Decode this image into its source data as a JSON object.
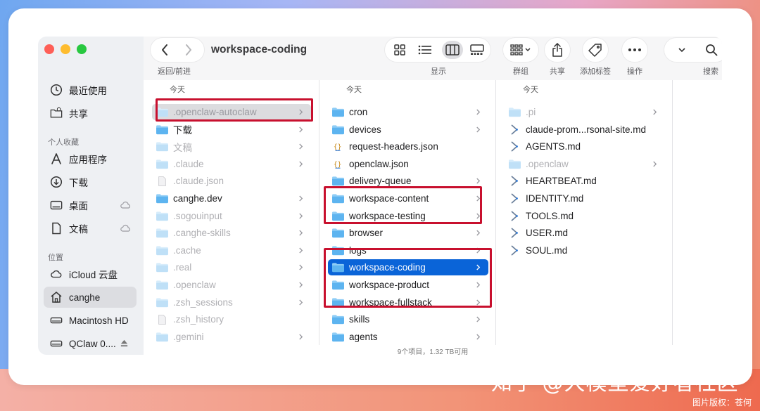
{
  "window_title": "workspace-coding",
  "toolbar": {
    "back_forward_label": "返回/前进",
    "view_label": "显示",
    "group_label": "群组",
    "share_label": "共享",
    "tags_label": "添加标签",
    "actions_label": "操作",
    "search_label": "搜索"
  },
  "sidebar": {
    "items_top": [
      {
        "label": "最近使用",
        "icon": "clock-icon"
      },
      {
        "label": "共享",
        "icon": "shared-folder-icon"
      }
    ],
    "favorites_title": "个人收藏",
    "favorites": [
      {
        "label": "应用程序",
        "icon": "applications-icon"
      },
      {
        "label": "下载",
        "icon": "download-icon"
      },
      {
        "label": "桌面",
        "icon": "desktop-icon"
      },
      {
        "label": "文稿",
        "icon": "document-icon"
      }
    ],
    "locations_title": "位置",
    "locations": [
      {
        "label": "iCloud 云盘",
        "icon": "cloud-icon"
      },
      {
        "label": "canghe",
        "icon": "home-icon"
      },
      {
        "label": "Macintosh HD",
        "icon": "disk-icon"
      },
      {
        "label": "QClaw 0....",
        "icon": "external-disk-icon"
      }
    ]
  },
  "columns": [
    {
      "header": "今天",
      "rows": [
        {
          "label": ".openclaw-autoclaw",
          "type": "folder",
          "dim": true,
          "chevron": true,
          "state": "selected-inactive"
        },
        {
          "label": "下载",
          "type": "folder",
          "dim": false,
          "chevron": true
        },
        {
          "label": "文稿",
          "type": "folder",
          "dim": true,
          "chevron": true
        },
        {
          "label": ".claude",
          "type": "folder",
          "dim": true,
          "chevron": true
        },
        {
          "label": ".claude.json",
          "type": "file",
          "dim": true,
          "chevron": false
        },
        {
          "label": "canghe.dev",
          "type": "folder",
          "dim": false,
          "chevron": true
        },
        {
          "label": ".sogouinput",
          "type": "folder",
          "dim": true,
          "chevron": true
        },
        {
          "label": ".canghe-skills",
          "type": "folder",
          "dim": true,
          "chevron": true
        },
        {
          "label": ".cache",
          "type": "folder",
          "dim": true,
          "chevron": true
        },
        {
          "label": ".real",
          "type": "folder",
          "dim": true,
          "chevron": true
        },
        {
          "label": ".openclaw",
          "type": "folder",
          "dim": true,
          "chevron": true
        },
        {
          "label": ".zsh_sessions",
          "type": "folder",
          "dim": true,
          "chevron": true
        },
        {
          "label": ".zsh_history",
          "type": "file",
          "dim": true,
          "chevron": false
        },
        {
          "label": ".gemini",
          "type": "folder",
          "dim": true,
          "chevron": true
        }
      ]
    },
    {
      "header": "今天",
      "rows": [
        {
          "label": "cron",
          "type": "folder",
          "dim": false,
          "chevron": true
        },
        {
          "label": "devices",
          "type": "folder",
          "dim": false,
          "chevron": true
        },
        {
          "label": "request-headers.json",
          "type": "json",
          "dim": false,
          "chevron": false
        },
        {
          "label": "openclaw.json",
          "type": "json",
          "dim": false,
          "chevron": false
        },
        {
          "label": "delivery-queue",
          "type": "folder",
          "dim": false,
          "chevron": true
        },
        {
          "label": "workspace-content",
          "type": "folder",
          "dim": false,
          "chevron": true
        },
        {
          "label": "workspace-testing",
          "type": "folder",
          "dim": false,
          "chevron": true
        },
        {
          "label": "browser",
          "type": "folder",
          "dim": false,
          "chevron": true
        },
        {
          "label": "logs",
          "type": "folder",
          "dim": false,
          "chevron": true
        },
        {
          "label": "workspace-coding",
          "type": "folder",
          "dim": false,
          "chevron": true,
          "state": "selected"
        },
        {
          "label": "workspace-product",
          "type": "folder",
          "dim": false,
          "chevron": true
        },
        {
          "label": "workspace-fullstack",
          "type": "folder",
          "dim": false,
          "chevron": true
        },
        {
          "label": "skills",
          "type": "folder",
          "dim": false,
          "chevron": true
        },
        {
          "label": "agents",
          "type": "folder",
          "dim": false,
          "chevron": true
        }
      ]
    },
    {
      "header": "今天",
      "rows": [
        {
          "label": ".pi",
          "type": "folder",
          "dim": true,
          "chevron": true
        },
        {
          "label": "claude-prom...rsonal-site.md",
          "type": "md",
          "dim": false,
          "chevron": false
        },
        {
          "label": "AGENTS.md",
          "type": "md",
          "dim": false,
          "chevron": false
        },
        {
          "label": ".openclaw",
          "type": "folder",
          "dim": true,
          "chevron": true
        },
        {
          "label": "HEARTBEAT.md",
          "type": "md",
          "dim": false,
          "chevron": false
        },
        {
          "label": "IDENTITY.md",
          "type": "md",
          "dim": false,
          "chevron": false
        },
        {
          "label": "TOOLS.md",
          "type": "md",
          "dim": false,
          "chevron": false
        },
        {
          "label": "USER.md",
          "type": "md",
          "dim": false,
          "chevron": false
        },
        {
          "label": "SOUL.md",
          "type": "md",
          "dim": false,
          "chevron": false
        }
      ]
    }
  ],
  "status_bar": "9个项目，1.32 TB可用",
  "watermark": "知乎 @大模型爱好者社区",
  "credit": "图片版权：苍何",
  "colors": {
    "accent": "#0a64d8",
    "highlight_box": "#c8102e",
    "folder": "#5db4f0"
  }
}
